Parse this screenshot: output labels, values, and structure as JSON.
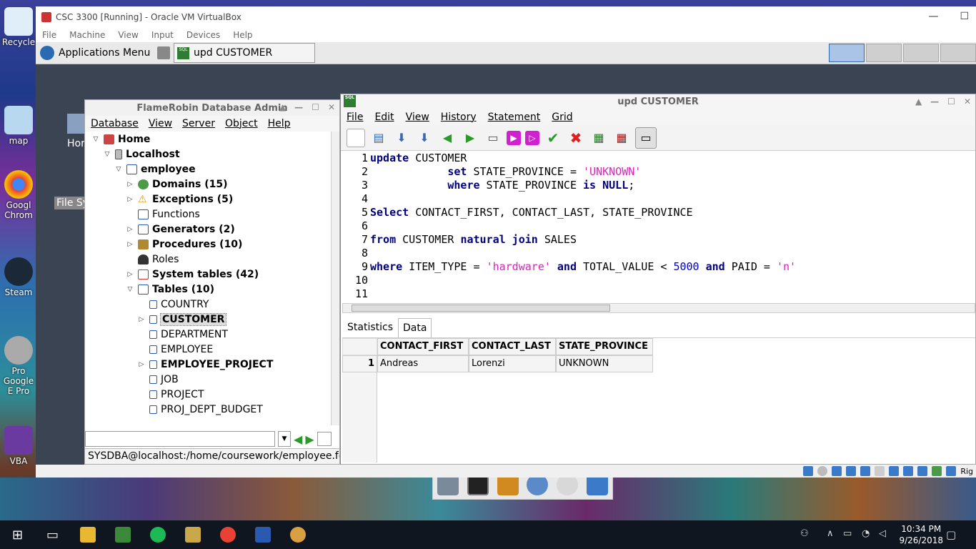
{
  "desktop": {
    "icons": [
      {
        "label": "Recycle",
        "color": "#ddeeff"
      },
      {
        "label": "map",
        "color": "#b8d8f0"
      },
      {
        "label": "Googl Chrom",
        "color": "#e94235"
      },
      {
        "label": "Steam",
        "color": "#1b2838"
      },
      {
        "label": "Pro Google E Pro",
        "color": "#aaaaaa"
      },
      {
        "label": "VBA",
        "color": "#6a3aa0"
      }
    ]
  },
  "vbox": {
    "title": "CSC 3300 [Running] - Oracle VM VirtualBox",
    "menu": [
      "File",
      "Machine",
      "View",
      "Input",
      "Devices",
      "Help"
    ],
    "minimize": "—",
    "maximize": "☐",
    "status_right": "Rig"
  },
  "panel": {
    "apps_menu": "Applications Menu",
    "task_label": "upd CUSTOMER"
  },
  "guest_desktop": {
    "icon1": "Hor",
    "icon2": "File Sy"
  },
  "flamerobin": {
    "title": "FlameRobin Database Admin",
    "menu": [
      "Database",
      "View",
      "Server",
      "Object",
      "Help"
    ],
    "tree": {
      "home": "Home",
      "localhost": "Localhost",
      "db": "employee",
      "domains": "Domains (15)",
      "exceptions": "Exceptions (5)",
      "functions": "Functions",
      "generators": "Generators (2)",
      "procedures": "Procedures (10)",
      "roles": "Roles",
      "system_tables": "System tables (42)",
      "tables": "Tables (10)",
      "t_country": "COUNTRY",
      "t_customer": "CUSTOMER",
      "t_department": "DEPARTMENT",
      "t_employee": "EMPLOYEE",
      "t_employee_project": "EMPLOYEE_PROJECT",
      "t_job": "JOB",
      "t_project": "PROJECT",
      "t_proj_dept_budget": "PROJ_DEPT_BUDGET"
    },
    "status": "SYSDBA@localhost:/home/coursework/employee.fdb"
  },
  "editor": {
    "title": "upd CUSTOMER",
    "menu": [
      "File",
      "Edit",
      "View",
      "History",
      "Statement",
      "Grid"
    ],
    "line_numbers": [
      "1",
      "2",
      "3",
      "4",
      "5",
      "6",
      "7",
      "8",
      "9",
      "10",
      "11"
    ],
    "line1": {
      "kw": "update",
      "rest": " CUSTOMER"
    },
    "line2": {
      "pad": "            ",
      "kw": "set",
      "rest": " STATE_PROVINCE = ",
      "str": "'UNKNOWN'"
    },
    "line3": {
      "pad": "            ",
      "kw": "where",
      "rest": " STATE_PROVINCE ",
      "kw2": "is",
      "kw3": " NULL",
      "end": ";"
    },
    "line5": {
      "kw": "Select",
      "rest": " CONTACT_FIRST, CONTACT_LAST, STATE_PROVINCE"
    },
    "line7": {
      "kw": "from",
      "rest": " CUSTOMER ",
      "kw2": "natural join",
      "rest2": " SALES"
    },
    "line9": {
      "kw": "where",
      "rest": " ITEM_TYPE = ",
      "str": "'hardware'",
      "kw2": " and",
      "rest2": " TOTAL_VALUE < ",
      "num": "5000",
      "kw3": " and",
      "rest3": " PAID = ",
      "str2": "'n'"
    },
    "tabs": [
      "Statistics",
      "Data"
    ],
    "grid": {
      "headers": [
        "CONTACT_FIRST",
        "CONTACT_LAST",
        "STATE_PROVINCE"
      ],
      "row_num": "1",
      "row": [
        "Andreas",
        "Lorenzi",
        "UNKNOWN"
      ]
    }
  },
  "taskbar": {
    "time": "10:34 PM",
    "date": "9/26/2018"
  }
}
